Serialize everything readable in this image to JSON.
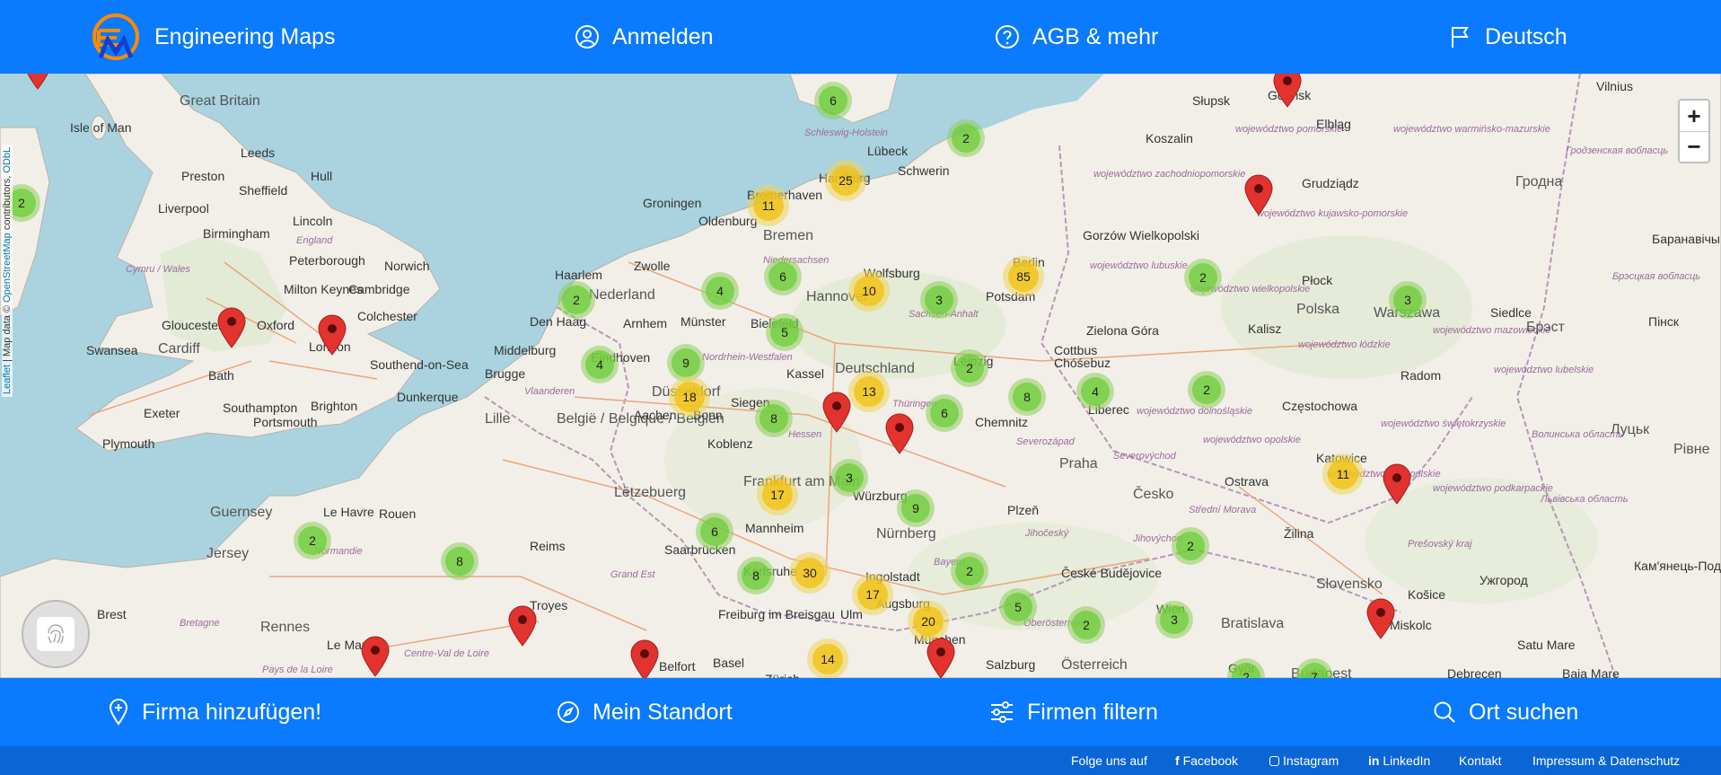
{
  "header": {
    "brand": "Engineering Maps",
    "login": "Anmelden",
    "terms": "AGB & mehr",
    "language": "Deutsch"
  },
  "map": {
    "zoom_in": "+",
    "zoom_out": "−",
    "attribution_leaflet": "Leaflet",
    "attribution_separator": "| Map data ©",
    "attribution_osm": "OpenStreetMap",
    "attribution_contrib": "contributors,",
    "attribution_odbl": "ODbL",
    "labels": {
      "great_britain": "Great Britain",
      "isle_of_man": "Isle of Man",
      "leeds": "Leeds",
      "preston": "Preston",
      "hull": "Hull",
      "sheffield": "Sheffield",
      "liverpool": "Liverpool",
      "lincoln": "Lincoln",
      "england": "England",
      "birmingham": "Birmingham",
      "peterborough": "Peterborough",
      "norwich": "Norwich",
      "cymru": "Cymru / Wales",
      "milton": "Milton Keynes",
      "cambridge": "Cambridge",
      "gloucester": "Gloucester",
      "oxford": "Oxford",
      "colchester": "Colchester",
      "swansea": "Swansea",
      "cardiff": "Cardiff",
      "london": "London",
      "southend": "Southend-on-Sea",
      "bath": "Bath",
      "exeter": "Exeter",
      "southampton": "Southampton",
      "brighton": "Brighton",
      "portsmouth": "Portsmouth",
      "plymouth": "Plymouth",
      "dunkerque": "Dunkerque",
      "groningen": "Groningen",
      "bremerhaven": "Bremerhaven",
      "oldenburg": "Oldenburg",
      "bremen": "Bremen",
      "hamburg": "Hamburg",
      "lubeck": "Lübeck",
      "schwerin": "Schwerin",
      "schleswig": "Schleswig-Holstein",
      "haarlem": "Haarlem",
      "zwolle": "Zwolle",
      "nederland": "Nederland",
      "den_haag": "Den Haag",
      "arnhem": "Arnhem",
      "munster": "Münster",
      "niedersachsen": "Niedersachsen",
      "hannover": "Hannover",
      "wolfsburg": "Wolfsburg",
      "potsdam": "Potsdam",
      "berlin": "Berlin",
      "middelburg": "Middelburg",
      "eindhoven": "Eindhoven",
      "bielefeld": "Bielefeld",
      "kassel": "Kassel",
      "deutschland": "Deutschland",
      "sachsen_anhalt": "Sachsen-Anhalt",
      "leipzig": "Leipzig",
      "cottbus": "Cottbus",
      "brugge": "Brugge",
      "nrw": "Nordrhein-Westfalen",
      "dusseldorf": "Düsseldorf",
      "aachen": "Aachen",
      "bonn": "Bonn",
      "siegen": "Siegen",
      "thuringen": "Thüringen",
      "chemnitz": "Chemnitz",
      "vlaanderen": "Vlaanderen",
      "lille": "Lille",
      "belgie": "België / Belgique / Belgien",
      "koblenz": "Koblenz",
      "hessen": "Hessen",
      "severozapad": "Severozápad",
      "praha": "Praha",
      "letzebuerg": "Lëtzebuerg",
      "frankfurt": "Frankfurt am Main",
      "wurzburg": "Würzburg",
      "cesko": "Česko",
      "guernsey": "Guernsey",
      "le_havre": "Le Havre",
      "rouen": "Rouen",
      "mannheim": "Mannheim",
      "nurnberg": "Nürnberg",
      "plzen": "Plzeň",
      "jersey": "Jersey",
      "normandie": "Normandie",
      "reims": "Reims",
      "saarbrucken": "Saarbrücken",
      "grand_est": "Grand Est",
      "karlsruhe": "Karlsruhe",
      "ingolstadt": "Ingolstadt",
      "bayern": "Bayern",
      "ceske_budejovice": "České Budějovice",
      "jihocesky": "Jihočeský",
      "brest": "Brest",
      "bretagne": "Bretagne",
      "rennes": "Rennes",
      "troyes": "Troyes",
      "freiburg": "Freiburg im Breisgau",
      "ulm": "Ulm",
      "augsburg": "Augsburg",
      "munchen": "München",
      "oberosterreich": "Oberösterreich",
      "wien": "Wien",
      "bratislava": "Bratislava",
      "le_mans": "Le Mans",
      "centre_loire": "Centre-Val de Loire",
      "pays_loire": "Pays de la Loire",
      "belfort": "Belfort",
      "basel": "Basel",
      "zurich": "Zürich",
      "salzburg": "Salzburg",
      "osterreich": "Österreich",
      "gyor": "Győr",
      "budapest": "Budapest",
      "debrecen": "Debrecen",
      "baia_mare": "Baia Mare",
      "satu_mare": "Satu Mare",
      "slupsk": "Słupsk",
      "gdansk": "Gdańsk",
      "elblag": "Elbląg",
      "koszalin": "Koszalin",
      "pomorskie": "województwo pomorskie",
      "zachodniopomorskie": "województwo zachodniopomorskie",
      "warminsko": "województwo warmińsko-mazurskie",
      "grudziadz": "Grudziądz",
      "kujawsko": "województwo kujawsko-pomorskie",
      "gorzow": "Gorzów Wielkopolski",
      "lubuskie": "województwo lubuskie",
      "wielkopolskie": "województwo wielkopolskie",
      "plock": "Płock",
      "polska": "Polska",
      "warszawa": "Warszawa",
      "mazowieckie": "województwo mazowieckie",
      "zielona_gora": "Zielona Góra",
      "kalisz": "Kalisz",
      "lodzkie": "województwo łódzkie",
      "chosebuz": "Chóśebuz",
      "siedlce": "Siedlce",
      "radom": "Radom",
      "liberec": "Liberec",
      "dolnoslaskie": "województwo dolnośląskie",
      "czestochowa": "Częstochowa",
      "opolskie": "województwo opolskie",
      "swietokrzyskie": "województwo świętokrzyskie",
      "lubelskie": "województwo lubelskie",
      "severovychod": "Severovýchod",
      "ostrava": "Ostrava",
      "katowice": "Katowice",
      "malopolskie": "województwo małopolskie",
      "podkarpackie": "województwo podkarpackie",
      "stredni_morava": "Střední Morava",
      "zilina": "Žilina",
      "jihovychod": "Jihovýchod",
      "presovsky": "Prešovský kraj",
      "slovensko": "Slovensko",
      "kosice": "Košice",
      "uzhorod": "Ужгород",
      "miskolc": "Miskolc",
      "vilnius": "Vilnius",
      "hrodna": "Гродна",
      "hrodzenskaja": "Гродзенская вобласць",
      "baranavichy": "Баранавічы",
      "brestskaja": "Брэсцкая вобласць",
      "brest_by": "Брэст",
      "pinsk": "Пінск",
      "volynska": "Волинська область",
      "lutsk": "Луцьк",
      "rivne": "Рівне",
      "lvivska": "Львівська область",
      "kamianets": "Кам'янець-Подільськ"
    },
    "clusters": [
      {
        "count": "6",
        "kind": "green"
      },
      {
        "count": "2",
        "kind": "green"
      },
      {
        "count": "2",
        "kind": "green"
      },
      {
        "count": "25",
        "kind": "yellow"
      },
      {
        "count": "11",
        "kind": "yellow"
      },
      {
        "count": "6",
        "kind": "green"
      },
      {
        "count": "2",
        "kind": "green"
      },
      {
        "count": "4",
        "kind": "green"
      },
      {
        "count": "10",
        "kind": "yellow"
      },
      {
        "count": "3",
        "kind": "green"
      },
      {
        "count": "85",
        "kind": "yellow"
      },
      {
        "count": "2",
        "kind": "green"
      },
      {
        "count": "3",
        "kind": "green"
      },
      {
        "count": "5",
        "kind": "green"
      },
      {
        "count": "4",
        "kind": "green"
      },
      {
        "count": "9",
        "kind": "green"
      },
      {
        "count": "2",
        "kind": "green"
      },
      {
        "count": "18",
        "kind": "yellow"
      },
      {
        "count": "13",
        "kind": "yellow"
      },
      {
        "count": "8",
        "kind": "green"
      },
      {
        "count": "4",
        "kind": "green"
      },
      {
        "count": "2",
        "kind": "green"
      },
      {
        "count": "8",
        "kind": "green"
      },
      {
        "count": "6",
        "kind": "green"
      },
      {
        "count": "3",
        "kind": "green"
      },
      {
        "count": "17",
        "kind": "yellow"
      },
      {
        "count": "9",
        "kind": "green"
      },
      {
        "count": "11",
        "kind": "yellow"
      },
      {
        "count": "2",
        "kind": "green"
      },
      {
        "count": "6",
        "kind": "green"
      },
      {
        "count": "2",
        "kind": "green"
      },
      {
        "count": "8",
        "kind": "green"
      },
      {
        "count": "8",
        "kind": "green"
      },
      {
        "count": "30",
        "kind": "yellow"
      },
      {
        "count": "17",
        "kind": "yellow"
      },
      {
        "count": "2",
        "kind": "green"
      },
      {
        "count": "5",
        "kind": "green"
      },
      {
        "count": "20",
        "kind": "yellow"
      },
      {
        "count": "2",
        "kind": "green"
      },
      {
        "count": "3",
        "kind": "green"
      },
      {
        "count": "14",
        "kind": "yellow"
      },
      {
        "count": "2",
        "kind": "green"
      },
      {
        "count": "7",
        "kind": "green"
      }
    ],
    "pin_color": "#e2332f"
  },
  "fingerprint": {
    "icon": "fingerprint-icon"
  },
  "bottombar": {
    "add_company": "Firma hinzufügen!",
    "my_location": "Mein Standort",
    "filter_companies": "Firmen filtern",
    "search_place": "Ort suchen"
  },
  "footer": {
    "follow": "Folge uns auf",
    "facebook": "Facebook",
    "instagram": "Instagram",
    "linkedin": "LinkedIn",
    "contact": "Kontakt",
    "imprint": "Impressum & Datenschutz"
  },
  "colors": {
    "brand_blue": "#0a7aff",
    "footer_blue": "#0a66d6",
    "cluster_green": "#6ecc39",
    "cluster_yellow": "#f0c20c",
    "sea": "#aad3df",
    "land": "#f2efe9"
  }
}
